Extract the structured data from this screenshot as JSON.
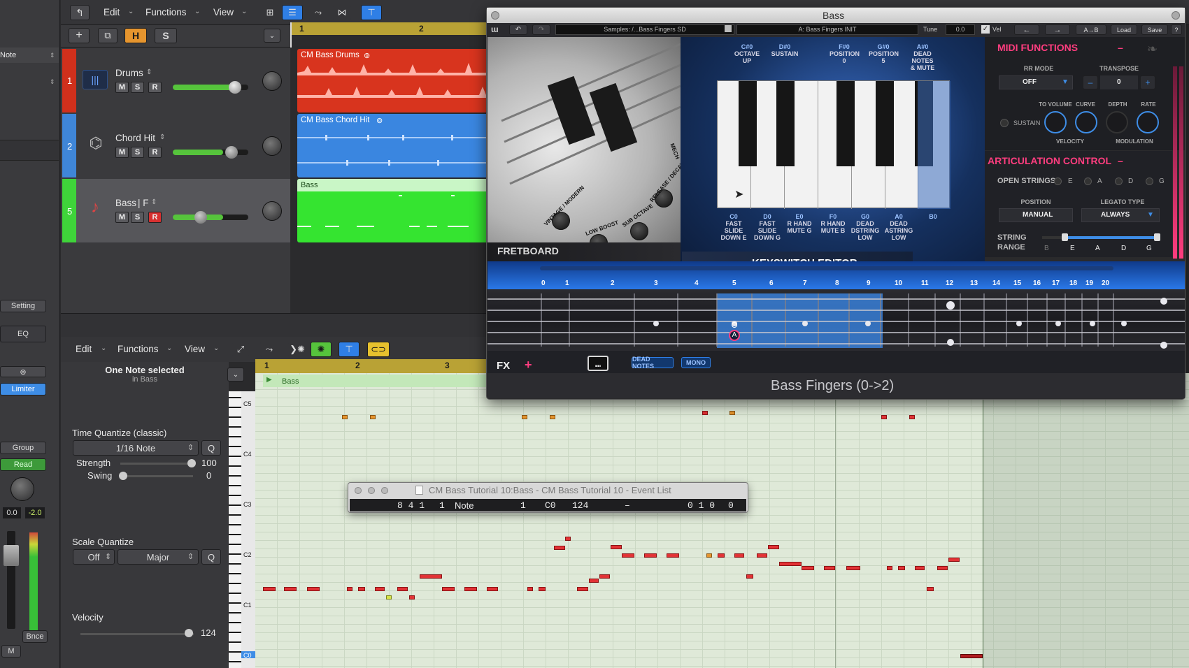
{
  "left_inspector": {
    "note_label": "Note",
    "setting": "Setting",
    "eq": "EQ",
    "limiter": "Limiter",
    "group": "Group",
    "read": "Read",
    "val_a": "0.0",
    "val_b": "-2.0",
    "bnce": "Bnce",
    "m": "M"
  },
  "tracks_toolbar": {
    "edit": "Edit",
    "functions": "Functions",
    "view": "View"
  },
  "header_buttons": {
    "plus": "+",
    "h": "H",
    "s": "S"
  },
  "ruler": {
    "bar1": "1",
    "bar2": "2"
  },
  "tracks": [
    {
      "num": "1",
      "name": "Drums",
      "mute": "M",
      "solo": "S",
      "rec": "R",
      "color": "#d0301c",
      "region": "CM Bass Drums",
      "region_color": "#d8341e"
    },
    {
      "num": "2",
      "name": "Chord Hit",
      "mute": "M",
      "solo": "S",
      "rec": "R",
      "color": "#3f86d8",
      "region": "CM Bass Chord Hit",
      "region_color": "#3a86e0"
    },
    {
      "num": "5",
      "name": "Bass",
      "name_suffix": "F",
      "mute": "M",
      "solo": "S",
      "rec": "R",
      "color": "#3fd43a",
      "region": "Bass",
      "region_color": "#35e430"
    }
  ],
  "piano_toolbar": {
    "edit": "Edit",
    "functions": "Functions",
    "view": "View"
  },
  "piano_ruler": {
    "bar1": "1",
    "bar2": "2",
    "bar3": "3"
  },
  "region_name": "Bass",
  "inspector": {
    "selection": "One Note selected",
    "selection_sub": "in Bass",
    "time_quantize_label": "Time Quantize (classic)",
    "time_quantize_value": "1/16 Note",
    "q": "Q",
    "strength_label": "Strength",
    "strength_value": "100",
    "swing_label": "Swing",
    "swing_value": "0",
    "scale_quantize_label": "Scale Quantize",
    "scale_off": "Off",
    "scale_mode": "Major",
    "velocity_label": "Velocity",
    "velocity_value": "124"
  },
  "key_labels": [
    "C5",
    "C4",
    "C3",
    "C2",
    "C1",
    "C0"
  ],
  "event_list": {
    "title": "CM Bass Tutorial 10:Bass - CM Bass Tutorial 10 - Event List",
    "position": "8 4 1",
    "sub": "1",
    "type": "Note",
    "channel": "1",
    "pitch": "C0",
    "velocity": "124",
    "dash": "–",
    "length": "0 1 0",
    "extra": "0"
  },
  "plugin": {
    "title": "Bass",
    "samples": "Samples: /...Bass Fingers SD",
    "preset": "A: Bass Fingers INIT",
    "tune_label": "Tune",
    "tune_value": "0.0",
    "vel": "Vel",
    "ab": "A→B",
    "load": "Load",
    "save": "Save",
    "help": "?",
    "fretboard": "FRETBOARD",
    "keyswitch_editor": "KEYSWITCH EDITOR",
    "top_keyswitches": [
      {
        "note": "C#0",
        "line1": "OCTAVE",
        "line2": "UP",
        "line3": ""
      },
      {
        "note": "D#0",
        "line1": "SUSTAIN",
        "line2": "",
        "line3": ""
      },
      {
        "note": "F#0",
        "line1": "POSITION",
        "line2": "0",
        "line3": ""
      },
      {
        "note": "G#0",
        "line1": "POSITION",
        "line2": "5",
        "line3": ""
      },
      {
        "note": "A#0",
        "line1": "DEAD",
        "line2": "NOTES",
        "line3": "& MUTE"
      }
    ],
    "bottom_keyswitches": [
      {
        "note": "C0",
        "line1": "FAST",
        "line2": "SLIDE",
        "line3": "DOWN E"
      },
      {
        "note": "D0",
        "line1": "FAST",
        "line2": "SLIDE",
        "line3": "DOWN G"
      },
      {
        "note": "E0",
        "line1": "R HAND",
        "line2": "MUTE G",
        "line3": ""
      },
      {
        "note": "F0",
        "line1": "R HAND",
        "line2": "MUTE B",
        "line3": ""
      },
      {
        "note": "G0",
        "line1": "DEAD",
        "line2": "DSTRING",
        "line3": "LOW"
      },
      {
        "note": "A0",
        "line1": "DEAD",
        "line2": "ASTRING",
        "line3": "LOW"
      },
      {
        "note": "B0",
        "line1": "",
        "line2": "",
        "line3": ""
      }
    ],
    "guitar_knobs": [
      "VINTAGE / MODERN",
      "LOW BOOST",
      "SUB OCTAVE",
      "RELEASE / DECAY",
      "MECH"
    ],
    "midi_functions": "MIDI FUNCTIONS",
    "rr_mode_label": "RR MODE",
    "rr_mode_value": "OFF",
    "transpose_label": "TRANSPOSE",
    "transpose_value": "0",
    "minus": "–",
    "plus": "+",
    "to_volume": "TO VOLUME",
    "curve": "CURVE",
    "depth": "DEPTH",
    "rate": "RATE",
    "sustain": "SUSTAIN",
    "velocity": "VELOCITY",
    "modulation": "MODULATION",
    "articulation": "ARTICULATION CONTROL",
    "open_strings": "OPEN STRINGS",
    "strings": [
      "E",
      "A",
      "D",
      "G"
    ],
    "position_label": "POSITION",
    "position_value": "MANUAL",
    "legato_label": "LEGATO TYPE",
    "legato_value": "ALWAYS",
    "string_range_label1": "STRING",
    "string_range_label2": "RANGE",
    "range_strings": [
      "B",
      "E",
      "A",
      "D",
      "G"
    ],
    "fret_numbers": [
      "0",
      "1",
      "2",
      "3",
      "4",
      "5",
      "6",
      "7",
      "8",
      "9",
      "10",
      "11",
      "12",
      "13",
      "14",
      "15",
      "16",
      "17",
      "18",
      "19",
      "20"
    ],
    "fx": "FX",
    "fx_plus": "+",
    "dead_notes": "DEAD NOTES",
    "mono": "MONO",
    "circle_label": "A",
    "instrument": "Bass Fingers (0->2)"
  },
  "colors": {
    "accent_blue": "#2f7fe6",
    "pink": "#ff3d7f",
    "green": "#56c43c"
  }
}
